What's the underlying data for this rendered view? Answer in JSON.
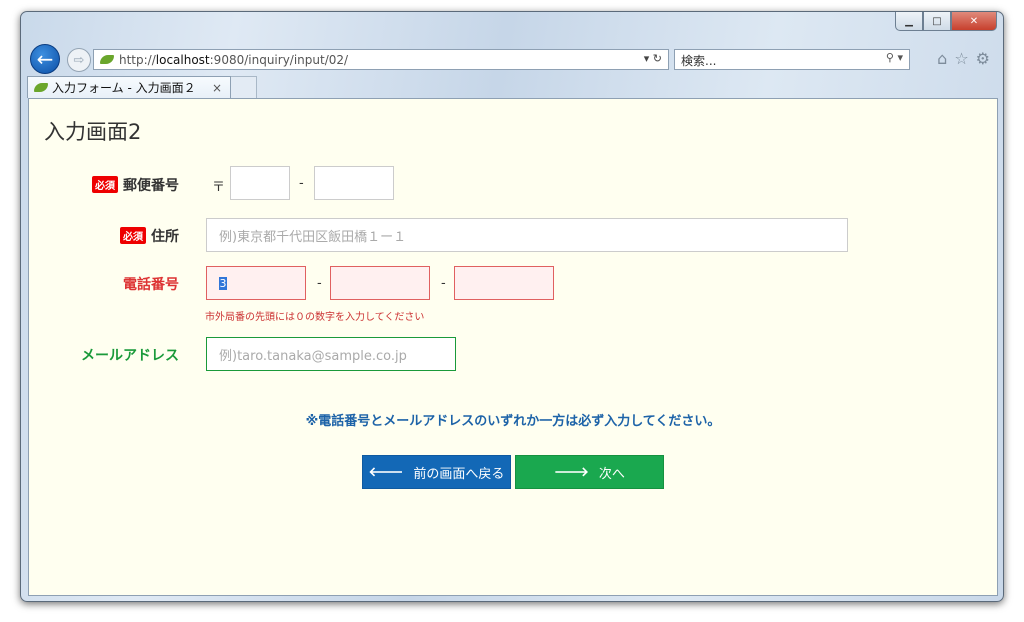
{
  "browser": {
    "url_prefix": "http://",
    "url_host": "localhost",
    "url_rest": ":9080/inquiry/input/02/",
    "search_placeholder": "検索...",
    "tab_title": "入力フォーム - 入力画面２",
    "tab_close": "×"
  },
  "page": {
    "title": "入力画面2",
    "required_badge": "必須",
    "postal": {
      "label": "郵便番号",
      "mark": "〒",
      "sep": "-"
    },
    "address": {
      "label": "住所",
      "placeholder": "例)東京都千代田区飯田橋１ー１"
    },
    "phone": {
      "label": "電話番号",
      "value": "3",
      "sep1": "-",
      "sep2": "-",
      "error": "市外局番の先頭には０の数字を入力してください"
    },
    "email": {
      "label": "メールアドレス",
      "placeholder": "例)taro.tanaka@sample.co.jp"
    },
    "notice": "※電話番号とメールアドレスのいずれか一方は必ず入力してください。",
    "back_button": "前の画面へ戻る",
    "next_button": "次へ"
  },
  "colors": {
    "required": "#ee0000",
    "error_label": "#dd3333",
    "email_label": "#1a9a3a",
    "notice": "#1d63a8",
    "back_btn": "#1368b6",
    "next_btn": "#1aa84f"
  }
}
